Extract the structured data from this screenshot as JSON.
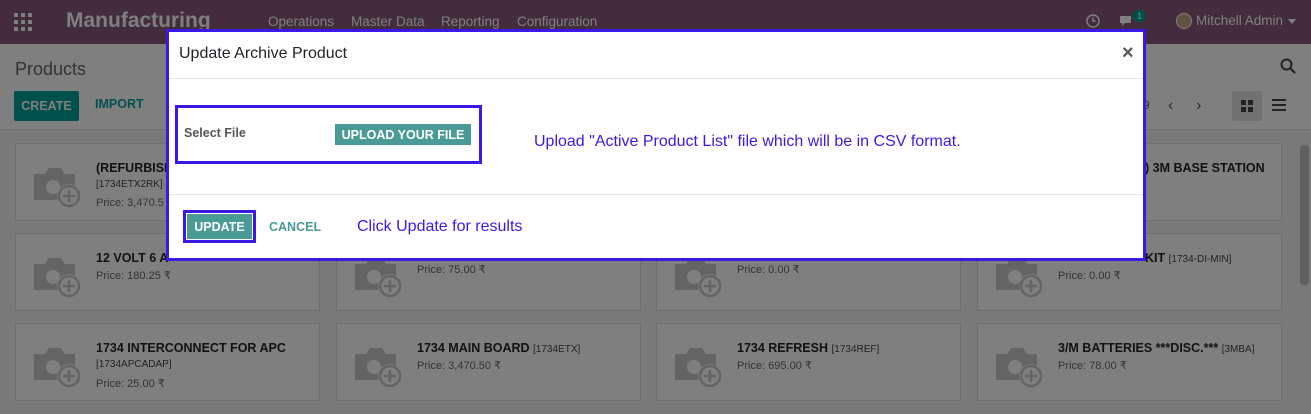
{
  "navbar": {
    "brand": "Manufacturing",
    "menu": [
      "Operations",
      "Master Data",
      "Reporting",
      "Configuration"
    ],
    "chat_count": "1",
    "user": "Mitchell Admin",
    "icons": [
      "apps-icon",
      "clock-icon",
      "chat-icon",
      "avatar",
      "caret-down-icon"
    ]
  },
  "control_panel": {
    "title": "Products",
    "create_label": "CREATE",
    "import_label": "IMPORT",
    "pager_value": "9",
    "pager_prev": "‹",
    "pager_next": "›"
  },
  "kanban": {
    "cards": [
      {
        "name": "(REFURBISH",
        "code": "",
        "sub1": "[1734ETX2RK]",
        "sub2": "Price: 3,470.5"
      },
      {
        "name": "",
        "code": "",
        "sub1": "",
        "sub2": ""
      },
      {
        "name": "",
        "code": "",
        "sub1": "",
        "sub2": ""
      },
      {
        "name": ") 3M BASE STATION",
        "code": "",
        "sub1": "",
        "sub2": ""
      },
      {
        "name": "12 VOLT 6 A",
        "code": "",
        "sub1": "Price: 180.25 ₹",
        "sub2": ""
      },
      {
        "name": "",
        "code": "",
        "sub1": "Price: 75.00 ₹",
        "sub2": ""
      },
      {
        "name": "",
        "code": "",
        "sub1": "Price: 0.00 ₹",
        "sub2": ""
      },
      {
        "name": "KIT",
        "code": "[1734-DI-MIN]",
        "sub1": "Price: 0.00 ₹",
        "sub2": ""
      },
      {
        "name": "1734 INTERCONNECT FOR APC",
        "code": "",
        "sub1": "[1734APCADAP]",
        "sub2": "Price: 25.00 ₹"
      },
      {
        "name": "1734 MAIN BOARD",
        "code": "[1734ETX]",
        "sub1": "Price: 3,470.50 ₹",
        "sub2": ""
      },
      {
        "name": "1734 REFRESH",
        "code": "[1734REF]",
        "sub1": "Price: 695.00 ₹",
        "sub2": ""
      },
      {
        "name": "3/M BATTERIES ***DISC.***",
        "code": "[3MBA]",
        "sub1": "Price: 78.00 ₹",
        "sub2": ""
      }
    ]
  },
  "modal": {
    "title": "Update Archive Product",
    "close": "×",
    "select_file_label": "Select File",
    "upload_label": "UPLOAD YOUR FILE",
    "upload_note": "Upload \"Active Product List\" file which will be in CSV format.",
    "update_label": "UPDATE",
    "cancel_label": "CANCEL",
    "update_note": "Click Update for results"
  },
  "colors": {
    "navbar": "#875a7b",
    "primary": "#00a09d",
    "annotation": "#3a19e6"
  }
}
